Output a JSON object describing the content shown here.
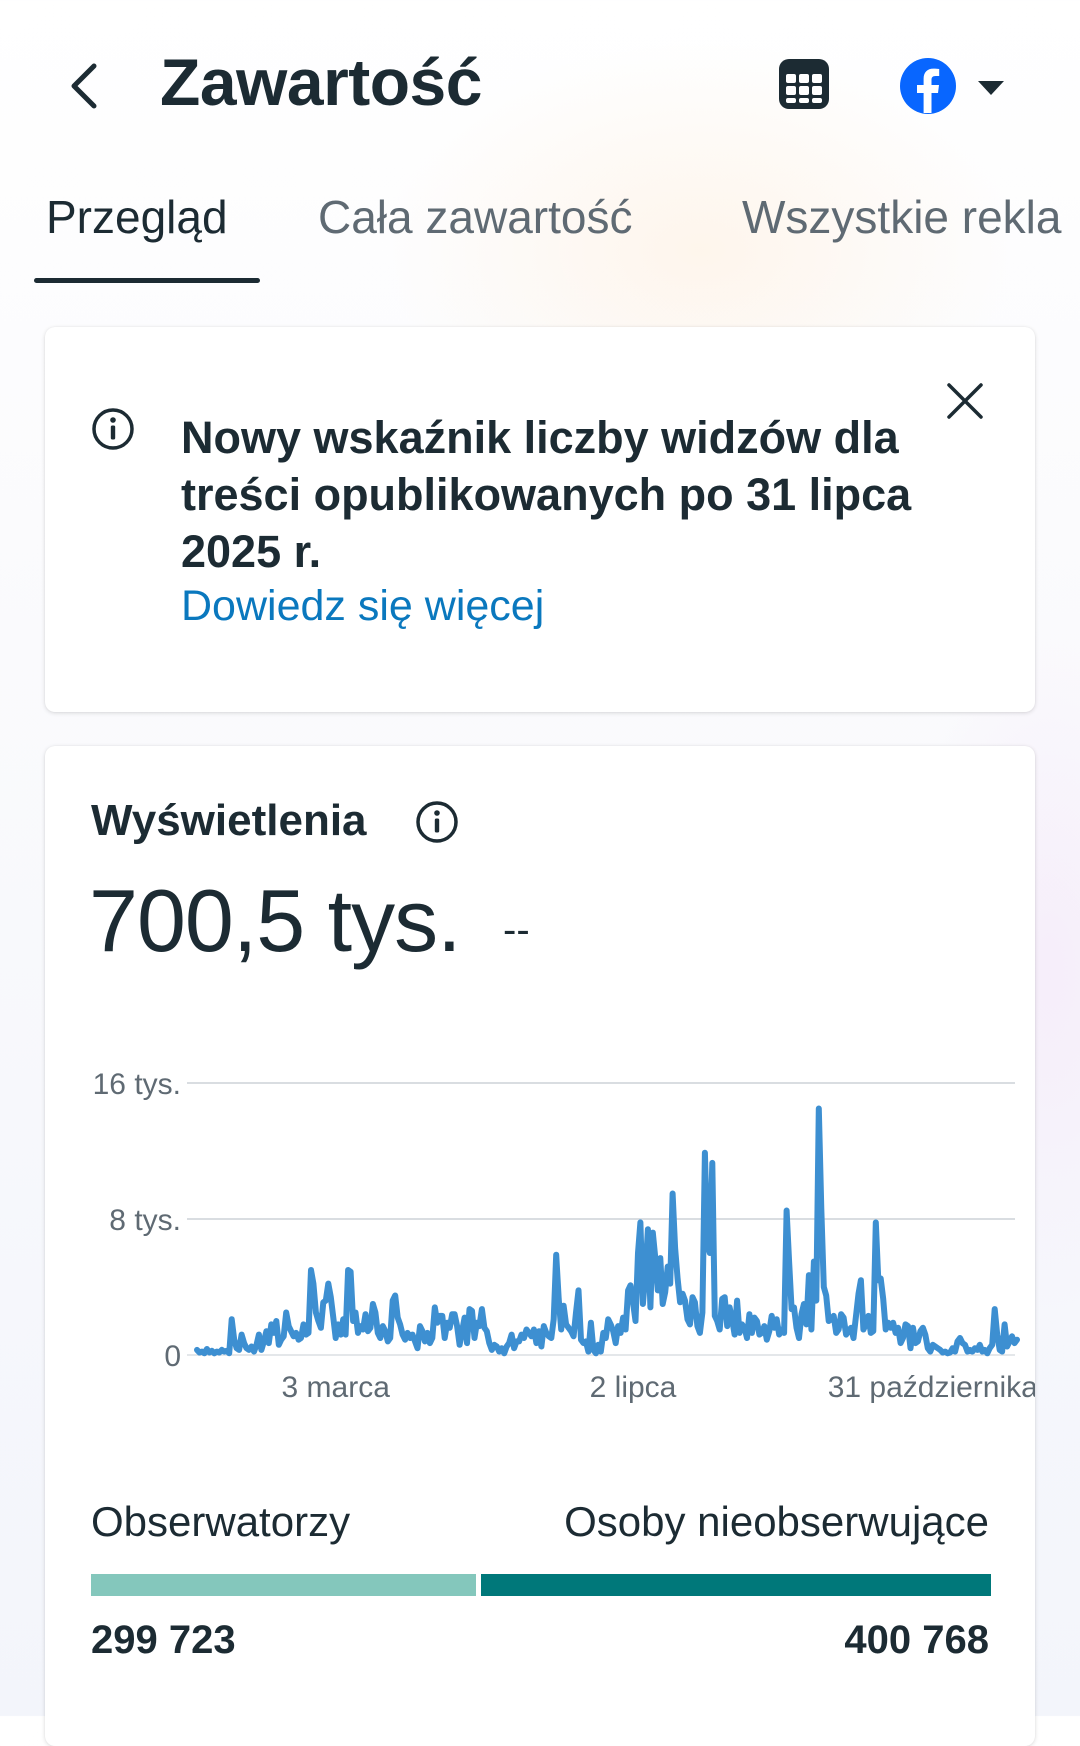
{
  "header": {
    "title": "Zawartość",
    "icons": [
      "chevron-left-icon",
      "table-icon",
      "facebook-icon",
      "caret-down-icon"
    ],
    "brand_color": "#0866ff"
  },
  "tabs": [
    {
      "label": "Przegląd",
      "active": true
    },
    {
      "label": "Cała zawartość",
      "active": false
    },
    {
      "label": "Wszystkie rekla",
      "active": false
    }
  ],
  "notice": {
    "text": "Nowy wskaźnik liczby widzów dla treści opublikowanych po 31 lipca 2025 r.",
    "link": "Dowiedz się więcej",
    "link_color": "#0a78be"
  },
  "views": {
    "label": "Wyświetlenia",
    "value": "700,5 tys.",
    "delta": "--"
  },
  "chart_data": {
    "type": "line",
    "color": "#3d8fd1",
    "ylim": [
      0,
      16000
    ],
    "y_ticks": [
      {
        "value": 0,
        "label": "0"
      },
      {
        "value": 8000,
        "label": "8 tys."
      },
      {
        "value": 16000,
        "label": "16 tys."
      }
    ],
    "x_ticks": [
      {
        "index": 56,
        "label": "3 marca"
      },
      {
        "index": 176,
        "label": "2 lipca"
      },
      {
        "index": 297,
        "label": "31 października"
      }
    ],
    "grid": true,
    "series": [
      {
        "values": [
          300,
          150,
          200,
          100,
          350,
          150,
          250,
          100,
          200,
          150,
          300,
          200,
          250,
          100,
          2100,
          900,
          400,
          300,
          1200,
          700,
          400,
          300,
          500,
          200,
          600,
          1200,
          300,
          800,
          1400,
          700,
          1800,
          1300,
          2000,
          600,
          900,
          1100,
          2500,
          1700,
          1400,
          1100,
          1300,
          900,
          1000,
          1800,
          1200,
          1300,
          5000,
          4200,
          2500,
          2000,
          1600,
          3100,
          3200,
          4200,
          3400,
          2200,
          1000,
          1800,
          1200,
          2100,
          1200,
          5000,
          4900,
          2000,
          2500,
          1300,
          1700,
          1500,
          2400,
          1400,
          1600,
          3000,
          2500,
          1300,
          1000,
          1700,
          1400,
          800,
          1000,
          3200,
          3500,
          2200,
          1800,
          1200,
          900,
          1300,
          1000,
          1200,
          800,
          400,
          1700,
          1400,
          800,
          1300,
          700,
          1000,
          2800,
          1900,
          2300,
          2300,
          1000,
          1900,
          1600,
          2400,
          2400,
          1700,
          600,
          1400,
          2200,
          700,
          2700,
          2600,
          1000,
          1900,
          1700,
          2700,
          1600,
          1400,
          700,
          300,
          600,
          500,
          200,
          400,
          100,
          500,
          700,
          1200,
          400,
          800,
          800,
          1200,
          1000,
          1500,
          1300,
          1100,
          1500,
          700,
          1400,
          500,
          1700,
          1300,
          1100,
          1000,
          2100,
          5900,
          3300,
          1500,
          2900,
          1800,
          1600,
          1400,
          1100,
          2500,
          3800,
          900,
          700,
          800,
          200,
          1900,
          300,
          100,
          600,
          200,
          1300,
          1000,
          2100,
          1800,
          1400,
          700,
          1700,
          1300,
          2200,
          1500,
          3800,
          4100,
          3100,
          2000,
          6000,
          7800,
          3000,
          4800,
          7400,
          2800,
          7200,
          5700,
          3800,
          5700,
          3000,
          3700,
          5200,
          4200,
          9500,
          6300,
          4500,
          3100,
          3600,
          3200,
          2100,
          1800,
          3400,
          3100,
          1700,
          1300,
          2500,
          11900,
          6500,
          6000,
          11300,
          2300,
          2000,
          1500,
          3300,
          3400,
          1700,
          2800,
          2100,
          1200,
          3200,
          1300,
          1800,
          1600,
          1000,
          2400,
          1300,
          2200,
          2000,
          1200,
          1300,
          1700,
          900,
          1400,
          2300,
          1600,
          2100,
          1200,
          1500,
          1300,
          8500,
          5500,
          2700,
          2800,
          1600,
          1000,
          2400,
          3000,
          1800,
          4700,
          1500,
          5500,
          3200,
          14500,
          8600,
          4000,
          3500,
          2000,
          2100,
          2300,
          1300,
          1500,
          2400,
          2200,
          1200,
          1400,
          1600,
          1000,
          2300,
          3600,
          4400,
          1500,
          1800,
          2300,
          1300,
          1400,
          7800,
          4400,
          4500,
          3300,
          1500,
          1900,
          1600,
          1900,
          1300,
          1600,
          700,
          1000,
          1800,
          1700,
          400,
          1600,
          700,
          800,
          1400,
          1600,
          1200,
          400,
          200,
          600,
          500,
          400,
          300,
          150,
          200,
          100,
          150,
          400,
          200,
          800,
          1000,
          700,
          600,
          200,
          300,
          200,
          400,
          300,
          600,
          200,
          300,
          100,
          400,
          600,
          2700,
          1200,
          300,
          200,
          1800,
          500,
          800,
          1100,
          700,
          900
        ]
      }
    ]
  },
  "audience": {
    "followers_label": "Obserwatorzy",
    "nonfollowers_label": "Osoby nieobserwujące",
    "followers_value": "299 723",
    "nonfollowers_value": "400 768",
    "followers_share": 0.428,
    "followers_color": "#84c7bc",
    "nonfollowers_color": "#00787a"
  }
}
